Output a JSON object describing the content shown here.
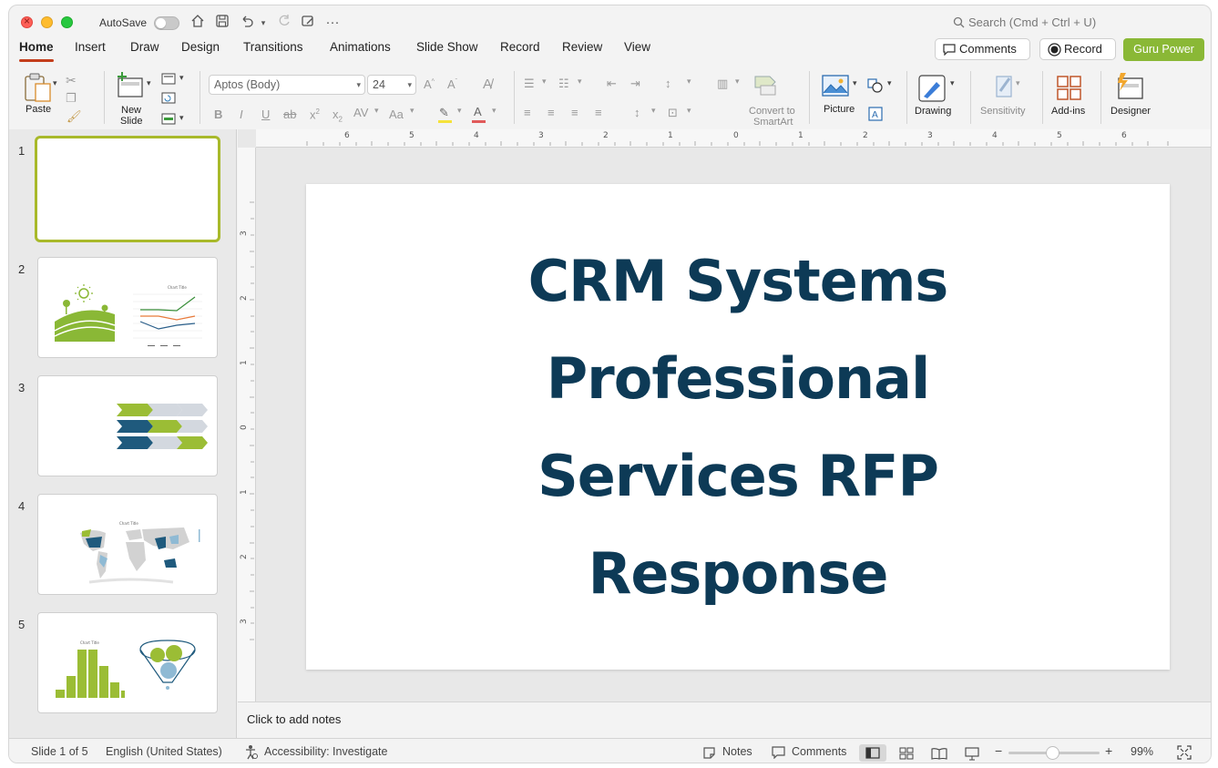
{
  "titlebar": {
    "autosave_label": "AutoSave",
    "search_placeholder": "Search (Cmd + Ctrl + U)"
  },
  "tabs": [
    {
      "label": "Home",
      "active": true
    },
    {
      "label": "Insert"
    },
    {
      "label": "Draw"
    },
    {
      "label": "Design"
    },
    {
      "label": "Transitions"
    },
    {
      "label": "Animations"
    },
    {
      "label": "Slide Show"
    },
    {
      "label": "Record"
    },
    {
      "label": "Review"
    },
    {
      "label": "View"
    }
  ],
  "header_buttons": {
    "comments": "Comments",
    "record": "Record",
    "guru": "Guru Power"
  },
  "ribbon": {
    "paste": "Paste",
    "new_slide_1": "New",
    "new_slide_2": "Slide",
    "font_name": "Aptos (Body)",
    "font_size": "24",
    "convert_1": "Convert to",
    "convert_2": "SmartArt",
    "picture": "Picture",
    "drawing": "Drawing",
    "sensitivity": "Sensitivity",
    "addins": "Add-ins",
    "designer": "Designer"
  },
  "slides": [
    {
      "number": "1"
    },
    {
      "number": "2"
    },
    {
      "number": "3"
    },
    {
      "number": "4"
    },
    {
      "number": "5"
    }
  ],
  "thumbnails": {
    "chart_title": "Chart Title"
  },
  "current_slide": {
    "title": "CRM Systems Professional Services RFP Response"
  },
  "notes_placeholder": "Click to add notes",
  "status": {
    "slide_position": "Slide 1 of 5",
    "language": "English (United States)",
    "accessibility": "Accessibility: Investigate",
    "notes": "Notes",
    "comments": "Comments",
    "zoom": "99%"
  },
  "colors": {
    "accent_green": "#8ab836",
    "title_navy": "#0d3a56",
    "tab_underline": "#c43e1c"
  }
}
